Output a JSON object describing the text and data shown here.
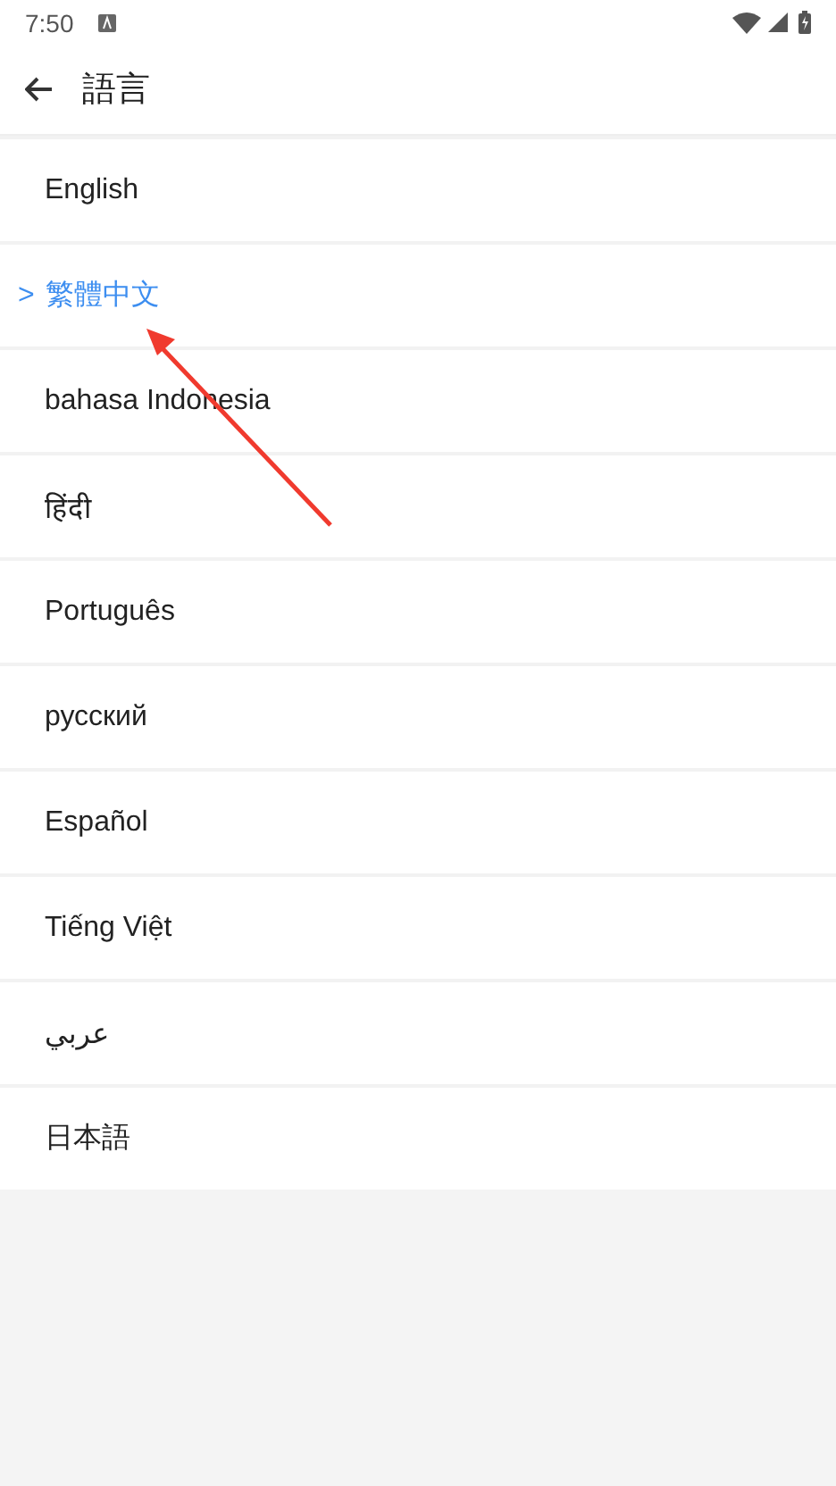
{
  "status_bar": {
    "time": "7:50"
  },
  "app_bar": {
    "title": "語言"
  },
  "selected_marker": ">",
  "languages": [
    {
      "label": "English",
      "selected": false
    },
    {
      "label": "繁體中文",
      "selected": true
    },
    {
      "label": "bahasa Indonesia",
      "selected": false
    },
    {
      "label": "हिंदी",
      "selected": false
    },
    {
      "label": "Português",
      "selected": false
    },
    {
      "label": "русский",
      "selected": false
    },
    {
      "label": "Español",
      "selected": false
    },
    {
      "label": "Tiếng Việt",
      "selected": false
    },
    {
      "label": "عربي",
      "selected": false
    },
    {
      "label": "日本語",
      "selected": false
    }
  ]
}
